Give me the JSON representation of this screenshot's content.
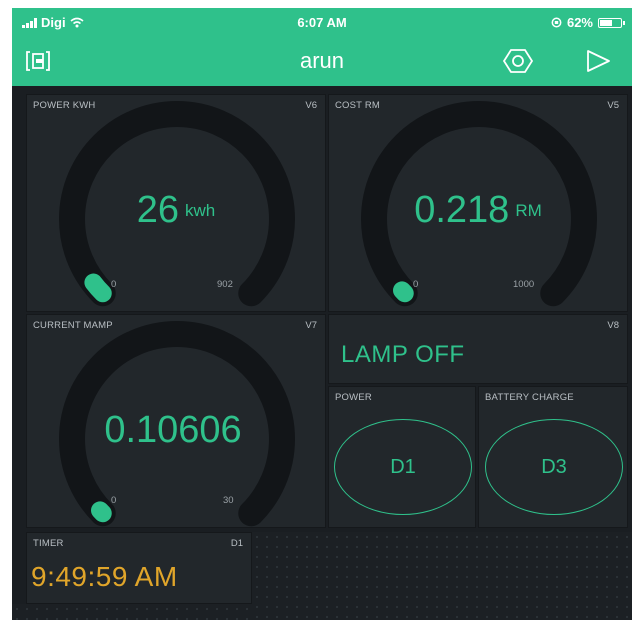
{
  "status_bar": {
    "carrier": "Digi",
    "time": "6:07 AM",
    "battery_text": "62%",
    "battery_level": 0.62
  },
  "header": {
    "title": "arun",
    "left_icon": "device-icon",
    "settings_icon": "hexagon-nut-icon",
    "play_icon": "play-icon"
  },
  "colors": {
    "accent": "#2fc18b",
    "tile_bg": "#22272b",
    "background": "#1a1e22",
    "timer": "#e0a52a",
    "gauge_track": "#121518"
  },
  "widgets": {
    "power_kwh": {
      "label": "POWER KWH",
      "pin": "V6",
      "value": "26",
      "unit": "kwh",
      "min": "0",
      "max": "902",
      "level": 0.0288
    },
    "cost_rm": {
      "label": "COST RM",
      "pin": "V5",
      "value": "0.218",
      "unit": "RM",
      "min": "0",
      "max": "1000",
      "level": 0.000218
    },
    "current_mamp": {
      "label": "CURRENT MAMP",
      "pin": "V7",
      "value": "0.10606",
      "unit": "",
      "min": "0",
      "max": "30",
      "level": 0.0035
    },
    "lamp": {
      "pin": "V8",
      "text": "LAMP OFF"
    },
    "power_button": {
      "label": "POWER",
      "text": "D1"
    },
    "battery_button": {
      "label": "BATTERY CHARGE",
      "text": "D3"
    },
    "timer": {
      "label": "TIMER",
      "pin": "D1",
      "value": "9:49:59 AM"
    }
  }
}
